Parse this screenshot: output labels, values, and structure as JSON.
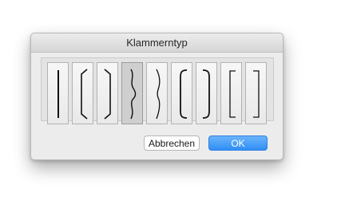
{
  "dialog": {
    "title": "Klammerntyp",
    "bracket_options": [
      {
        "icon": "bracket-single-line-icon",
        "selected": false
      },
      {
        "icon": "bracket-angled-corners-icon",
        "selected": false
      },
      {
        "icon": "bracket-angled-corners-right-icon",
        "selected": false
      },
      {
        "icon": "brace-wavy-icon",
        "selected": true
      },
      {
        "icon": "brace-wavy-thin-icon",
        "selected": false
      },
      {
        "icon": "bracket-round-corners-icon",
        "selected": false
      },
      {
        "icon": "bracket-round-corners-right-icon",
        "selected": false
      },
      {
        "icon": "square-bracket-left-icon",
        "selected": false
      },
      {
        "icon": "square-bracket-right-icon",
        "selected": false
      }
    ],
    "cancel_label": "Abbrechen",
    "ok_label": "OK"
  },
  "colors": {
    "ok_button": "#3b93f7",
    "selected_tile": "#cfcfcf"
  }
}
